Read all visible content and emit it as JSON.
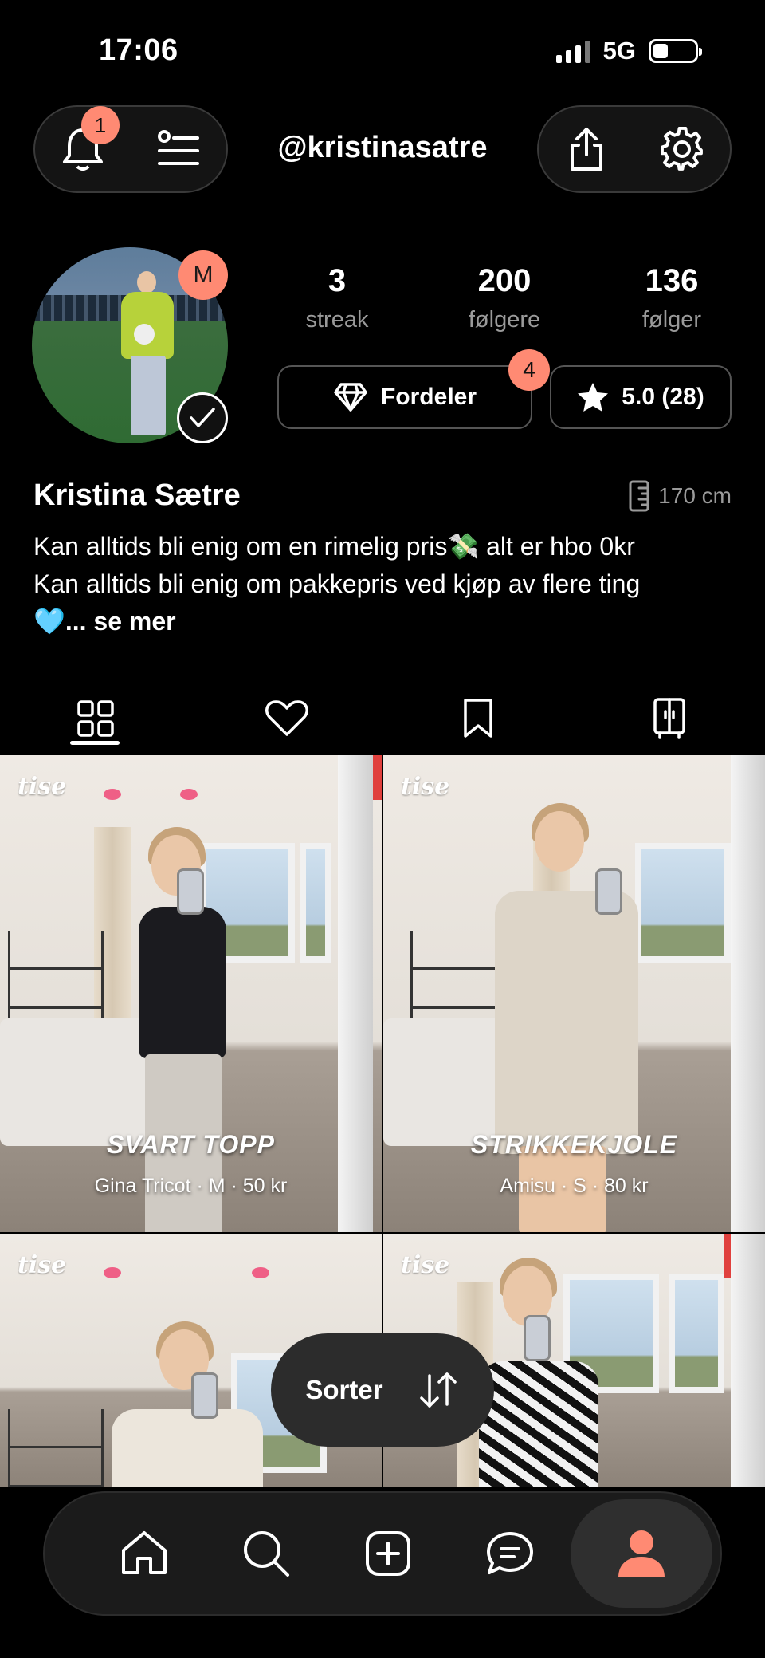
{
  "status": {
    "time": "17:06",
    "network": "5G"
  },
  "header": {
    "notification_count": "1",
    "username": "@kristinasatre"
  },
  "profile": {
    "avatar_badge": "M",
    "stats": {
      "streak_value": "3",
      "streak_label": "streak",
      "followers_value": "200",
      "followers_label": "følgere",
      "following_value": "136",
      "following_label": "følger"
    },
    "fordeler_label": "Fordeler",
    "fordeler_badge": "4",
    "rating_label": "5.0 (28)",
    "name": "Kristina Sætre",
    "height": "170 cm",
    "bio_line1": "Kan alltids bli enig om en rimelig pris💸 alt er hbo 0kr",
    "bio_line2": "Kan alltids bli enig om pakkepris ved kjøp av flere ting",
    "bio_line3_emoji": "🩵",
    "bio_more": "... se mer"
  },
  "tabs": [
    {
      "icon": "grid-icon",
      "active": true
    },
    {
      "icon": "heart-icon",
      "active": false
    },
    {
      "icon": "bookmark-icon",
      "active": false
    },
    {
      "icon": "wardrobe-icon",
      "active": false
    }
  ],
  "listings": [
    {
      "logo": "tise",
      "title": "SVART TOPP",
      "meta": "Gina Tricot · M · 50 kr"
    },
    {
      "logo": "tise",
      "title": "STRIKKEKJOLE",
      "meta": "Amisu · S · 80 kr"
    },
    {
      "logo": "tise",
      "title": "",
      "meta": ""
    },
    {
      "logo": "tise",
      "title": "",
      "meta": ""
    }
  ],
  "sort": {
    "label": "Sorter"
  },
  "bottom_nav": [
    {
      "icon": "home-icon"
    },
    {
      "icon": "search-icon"
    },
    {
      "icon": "add-icon"
    },
    {
      "icon": "chat-icon"
    },
    {
      "icon": "profile-icon",
      "active": true
    }
  ],
  "colors": {
    "accent": "#ff8a73",
    "background": "#000000",
    "muted": "#9a9a9a"
  }
}
